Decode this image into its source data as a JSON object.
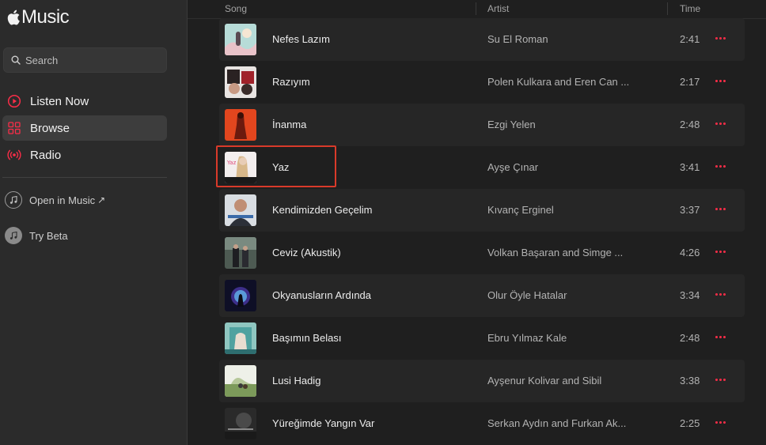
{
  "app": {
    "title": "Music"
  },
  "search": {
    "placeholder": "Search"
  },
  "nav": [
    {
      "label": "Listen Now",
      "icon": "play-circle-icon"
    },
    {
      "label": "Browse",
      "icon": "grid-icon",
      "active": true
    },
    {
      "label": "Radio",
      "icon": "radio-waves-icon"
    }
  ],
  "links": {
    "open_in_music": "Open in Music",
    "open_in_music_arrow": "↗",
    "try_beta": "Try Beta"
  },
  "columns": {
    "song": "Song",
    "artist": "Artist",
    "time": "Time"
  },
  "colors": {
    "accent": "#fa2d48",
    "highlight_box": "#d93a2a"
  },
  "tracks": [
    {
      "song": "Nefes Lazım",
      "artist": "Su El Roman",
      "time": "2:41"
    },
    {
      "song": "Razıyım",
      "artist": "Polen Kulkara and Eren Can ...",
      "time": "2:17"
    },
    {
      "song": "İnanma",
      "artist": "Ezgi Yelen",
      "time": "2:48"
    },
    {
      "song": "Yaz",
      "artist": "Ayşe Çınar",
      "time": "3:41"
    },
    {
      "song": "Kendimizden Geçelim",
      "artist": "Kıvanç Erginel",
      "time": "3:37"
    },
    {
      "song": "Ceviz (Akustik)",
      "artist": "Volkan Başaran and Simge ...",
      "time": "4:26"
    },
    {
      "song": "Okyanusların Ardında",
      "artist": "Olur Öyle Hatalar",
      "time": "3:34"
    },
    {
      "song": "Başımın Belası",
      "artist": "Ebru Yılmaz Kale",
      "time": "2:48"
    },
    {
      "song": "Lusi Hadig",
      "artist": "Ayşenur Kolivar and Sibil",
      "time": "3:38"
    },
    {
      "song": "Yüreğimde Yangın Var",
      "artist": "Serkan Aydın and Furkan Ak...",
      "time": "2:25"
    }
  ]
}
